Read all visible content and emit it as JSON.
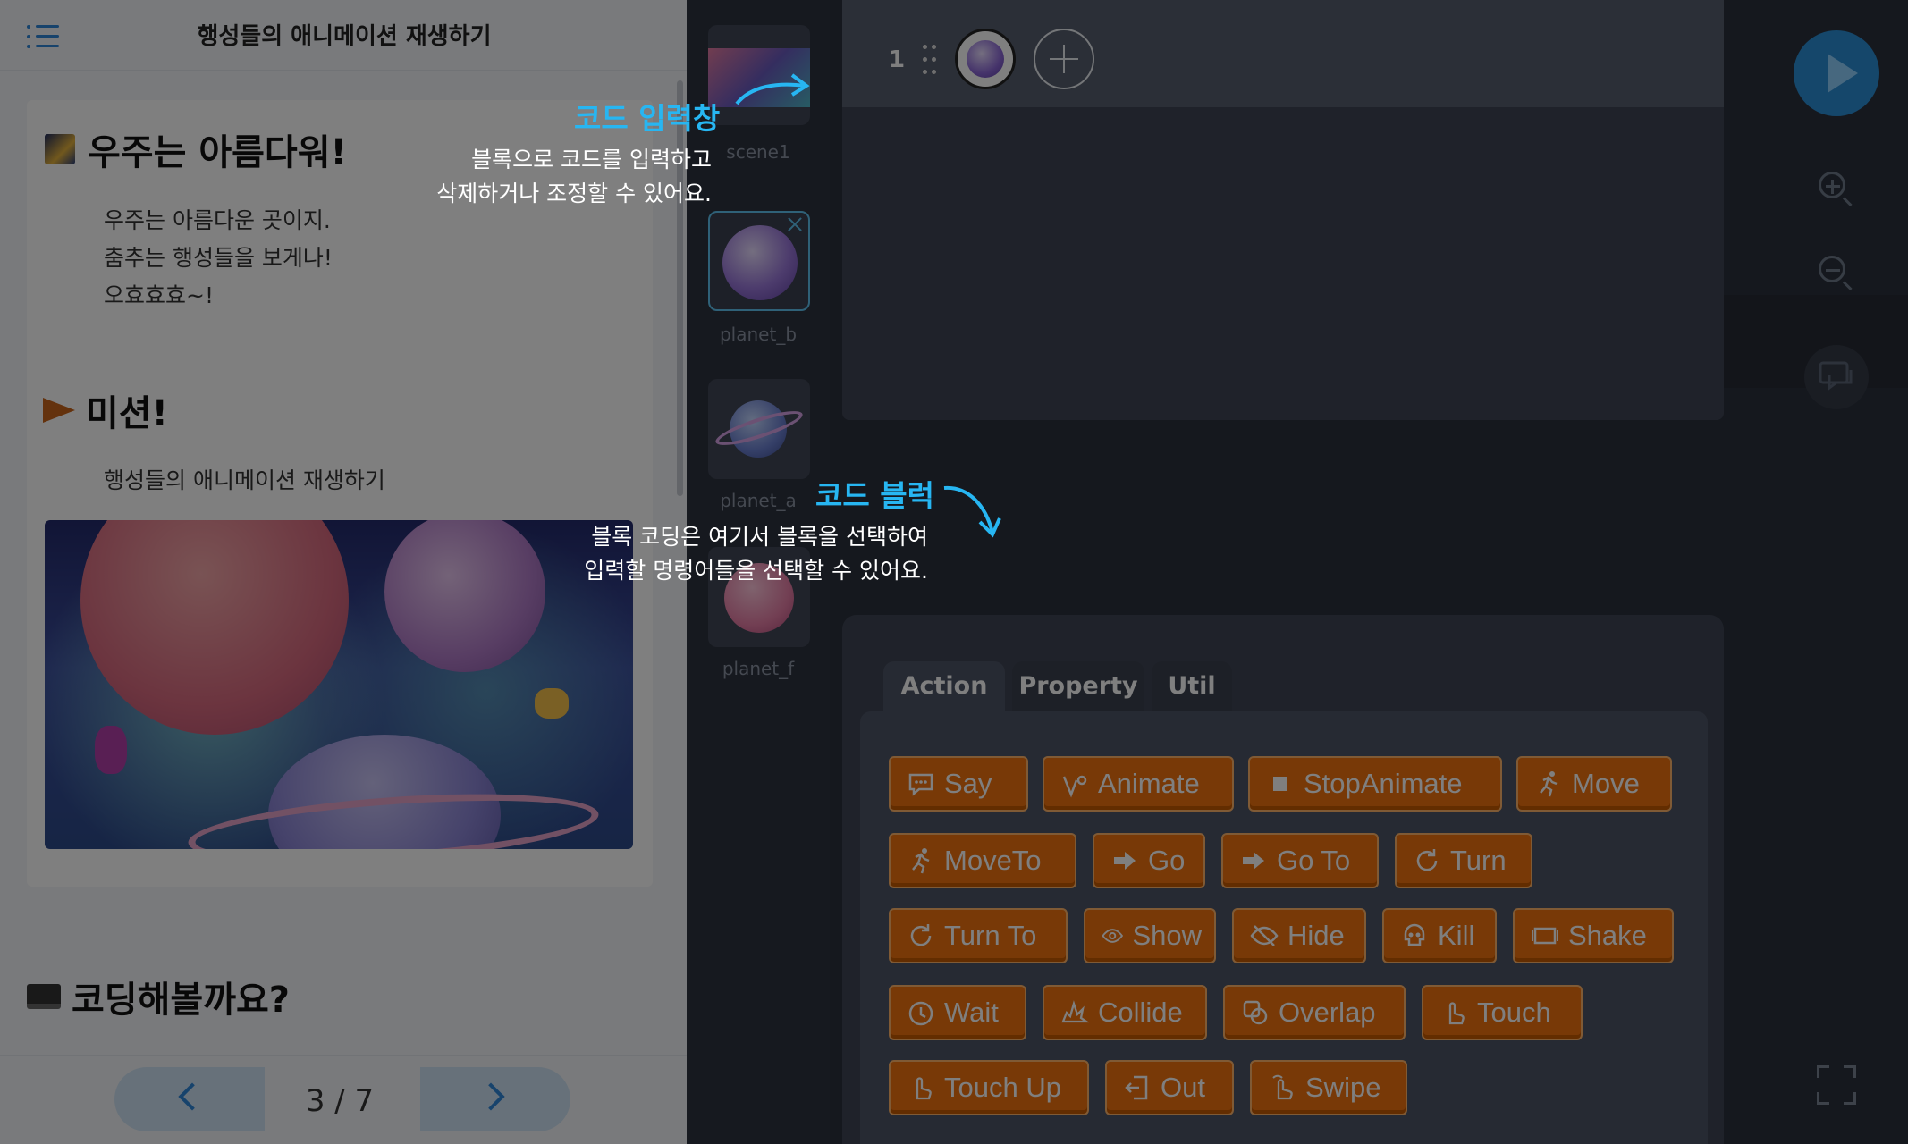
{
  "lesson": {
    "title": "행성들의 애니메이션 재생하기",
    "heading1": "우주는 아름다워!",
    "body_lines": [
      "우주는 아름다운 곳이지.",
      "춤추는 행성들을 보게나!",
      "오효효효~!"
    ],
    "heading2": "미션!",
    "mission_text": "행성들의 애니메이션 재생하기",
    "heading3": "코딩해볼까요?",
    "page": "3 / 7"
  },
  "sprites": [
    {
      "label": "scene1"
    },
    {
      "label": "planet_b"
    },
    {
      "label": "planet_a"
    },
    {
      "label": "planet_f"
    }
  ],
  "code": {
    "line_number": "1"
  },
  "palette": {
    "tabs": [
      "Action",
      "Property",
      "Util"
    ],
    "blocks": [
      {
        "label": "Say",
        "icon": "speech-bubble-icon"
      },
      {
        "label": "Animate",
        "icon": "animate-icon"
      },
      {
        "label": "StopAnimate",
        "icon": "stop-icon"
      },
      {
        "label": "Move",
        "icon": "running-icon"
      },
      {
        "label": "MoveTo",
        "icon": "running-icon"
      },
      {
        "label": "Go",
        "icon": "arrow-right-icon"
      },
      {
        "label": "Go To",
        "icon": "arrow-right-icon"
      },
      {
        "label": "Turn",
        "icon": "rotate-icon"
      },
      {
        "label": "Turn To",
        "icon": "rotate-icon"
      },
      {
        "label": "Show",
        "icon": "eye-icon"
      },
      {
        "label": "Hide",
        "icon": "eye-off-icon"
      },
      {
        "label": "Kill",
        "icon": "skull-icon"
      },
      {
        "label": "Shake",
        "icon": "shake-icon"
      },
      {
        "label": "Wait",
        "icon": "clock-icon"
      },
      {
        "label": "Collide",
        "icon": "collide-icon"
      },
      {
        "label": "Overlap",
        "icon": "overlap-icon"
      },
      {
        "label": "Touch",
        "icon": "hand-touch-icon"
      },
      {
        "label": "Touch Up",
        "icon": "hand-touch-icon"
      },
      {
        "label": "Out",
        "icon": "exit-icon"
      },
      {
        "label": "Swipe",
        "icon": "hand-swipe-icon"
      }
    ]
  },
  "tooltips": {
    "code_input": {
      "title": "코드 입력창",
      "lines": [
        "블록으로 코드를 입력하고",
        "삭제하거나 조정할 수 있어요."
      ]
    },
    "code_block": {
      "title": "코드 블럭",
      "lines": [
        "블록 코딩은 여기서 블록을 선택하여",
        "입력할 명령어들을 선택할 수 있어요."
      ]
    }
  },
  "colors": {
    "block_orange": "#f0730f",
    "accent_blue": "#27b6f2",
    "play_blue": "#2b8fd6"
  }
}
